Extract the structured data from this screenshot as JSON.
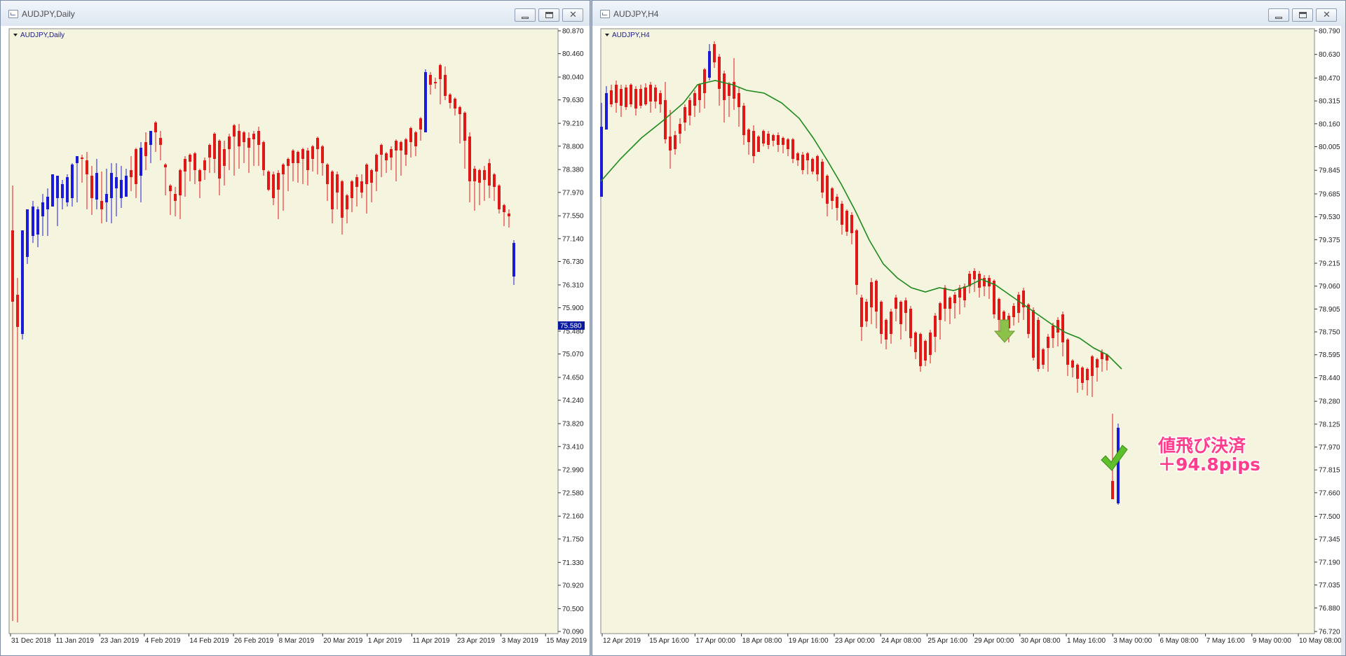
{
  "windows": [
    {
      "title": "AUDJPY,Daily",
      "symbol_label": "AUDJPY,Daily",
      "price_levels": [
        "80.870",
        "80.460",
        "80.040",
        "79.630",
        "79.210",
        "78.800",
        "78.380",
        "77.970",
        "77.550",
        "77.140",
        "76.730",
        "76.310",
        "75.900",
        "75.480",
        "75.070",
        "74.650",
        "74.240",
        "73.820",
        "73.410",
        "72.990",
        "72.580",
        "72.160",
        "71.750",
        "71.330",
        "70.920",
        "70.500",
        "70.090"
      ],
      "price_range": [
        70.09,
        80.87
      ],
      "current_price_label": "75.580",
      "current_price": 75.58,
      "time_labels": [
        "31 Dec 2018",
        "11 Jan 2019",
        "23 Jan 2019",
        "4 Feb 2019",
        "14 Feb 2019",
        "26 Feb 2019",
        "8 Mar 2019",
        "20 Mar 2019",
        "1 Apr 2019",
        "11 Apr 2019",
        "23 Apr 2019",
        "3 May 2019",
        "15 May 2019"
      ]
    },
    {
      "title": "AUDJPY,H4",
      "symbol_label": "AUDJPY,H4",
      "price_levels": [
        "80.790",
        "80.630",
        "80.470",
        "80.315",
        "80.160",
        "80.005",
        "79.845",
        "79.685",
        "79.530",
        "79.375",
        "79.215",
        "79.060",
        "78.905",
        "78.750",
        "78.595",
        "78.440",
        "78.280",
        "78.125",
        "77.970",
        "77.815",
        "77.660",
        "77.500",
        "77.345",
        "77.190",
        "77.035",
        "76.880",
        "76.720"
      ],
      "price_range": [
        76.72,
        80.79
      ],
      "time_labels": [
        "12 Apr 2019",
        "15 Apr 16:00",
        "17 Apr 00:00",
        "18 Apr 08:00",
        "19 Apr 16:00",
        "23 Apr 00:00",
        "24 Apr 08:00",
        "25 Apr 16:00",
        "29 Apr 00:00",
        "30 Apr 08:00",
        "1 May 16:00",
        "3 May 00:00",
        "6 May 08:00",
        "7 May 16:00",
        "9 May 00:00",
        "10 May 08:00"
      ],
      "annotation": {
        "line1": "値飛び決済",
        "line2": "＋94.8pips"
      }
    }
  ],
  "colors": {
    "chart_bg": "#f5f4de",
    "bull": "#1a1ad9",
    "bear": "#e01818",
    "grid_text": "#2222aa",
    "ma_line": "#1e8a1e",
    "annotation_fill": "#ff3d8c",
    "check": "#5fbf2a",
    "arrow": "#8cc24a"
  },
  "icons": [
    "chart-window-icon",
    "minimize-icon",
    "maximize-icon",
    "close-icon",
    "dropdown-triangle-icon",
    "checkmark-icon",
    "down-arrow-icon"
  ]
}
